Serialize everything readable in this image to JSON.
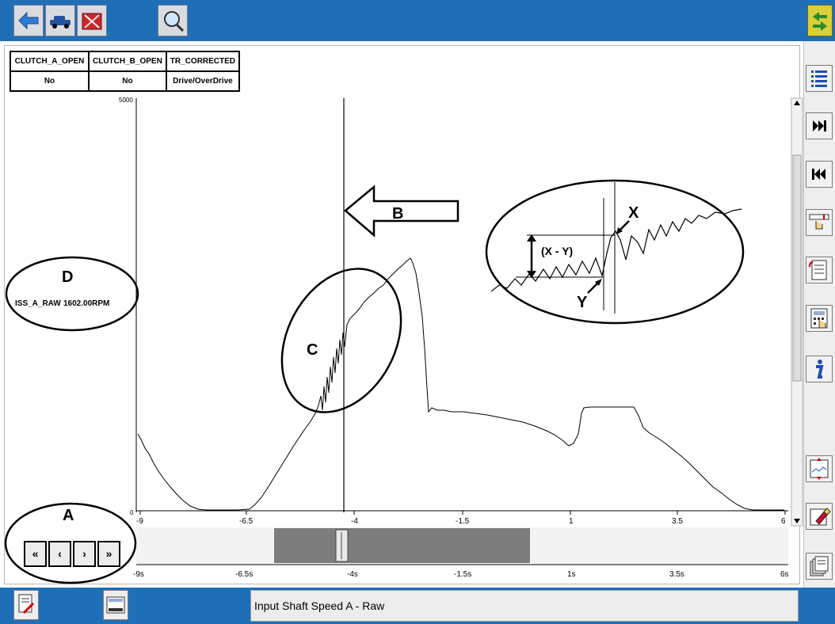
{
  "window": {
    "accent": "#1f6fb8"
  },
  "toolbar": {
    "buttons": [
      {
        "name": "navigate-icon"
      },
      {
        "name": "vehicle-icon"
      },
      {
        "name": "toolbox-icon"
      },
      {
        "name": "search-tool-icon"
      }
    ]
  },
  "pid_table": {
    "headers": [
      "CLUTCH_A_OPEN",
      "CLUTCH_B_OPEN",
      "TR_CORRECTED"
    ],
    "values": [
      "No",
      "No",
      "Drive/OverDrive"
    ]
  },
  "graph": {
    "y_max_label": "5000",
    "y_min_label": "0",
    "axis_ticks": [
      "-9",
      "-6.5",
      "-4",
      "-1.5",
      "1",
      "3.5",
      "6"
    ],
    "scroll_ticks": [
      "-9s",
      "-6.5s",
      "-4s",
      "-1.5s",
      "1s",
      "3.5s",
      "6s"
    ],
    "pid_readout": {
      "name": "ISS_A_RAW",
      "value": "1602.00RPM"
    }
  },
  "annotations": {
    "a": "A",
    "b": "B",
    "c": "C",
    "d": "D",
    "x": "X",
    "y": "Y",
    "xy": "(X - Y)"
  },
  "playback": {
    "buttons": [
      "«",
      "‹",
      "›",
      "»"
    ]
  },
  "status": {
    "text": "Input Shaft Speed A - Raw"
  }
}
